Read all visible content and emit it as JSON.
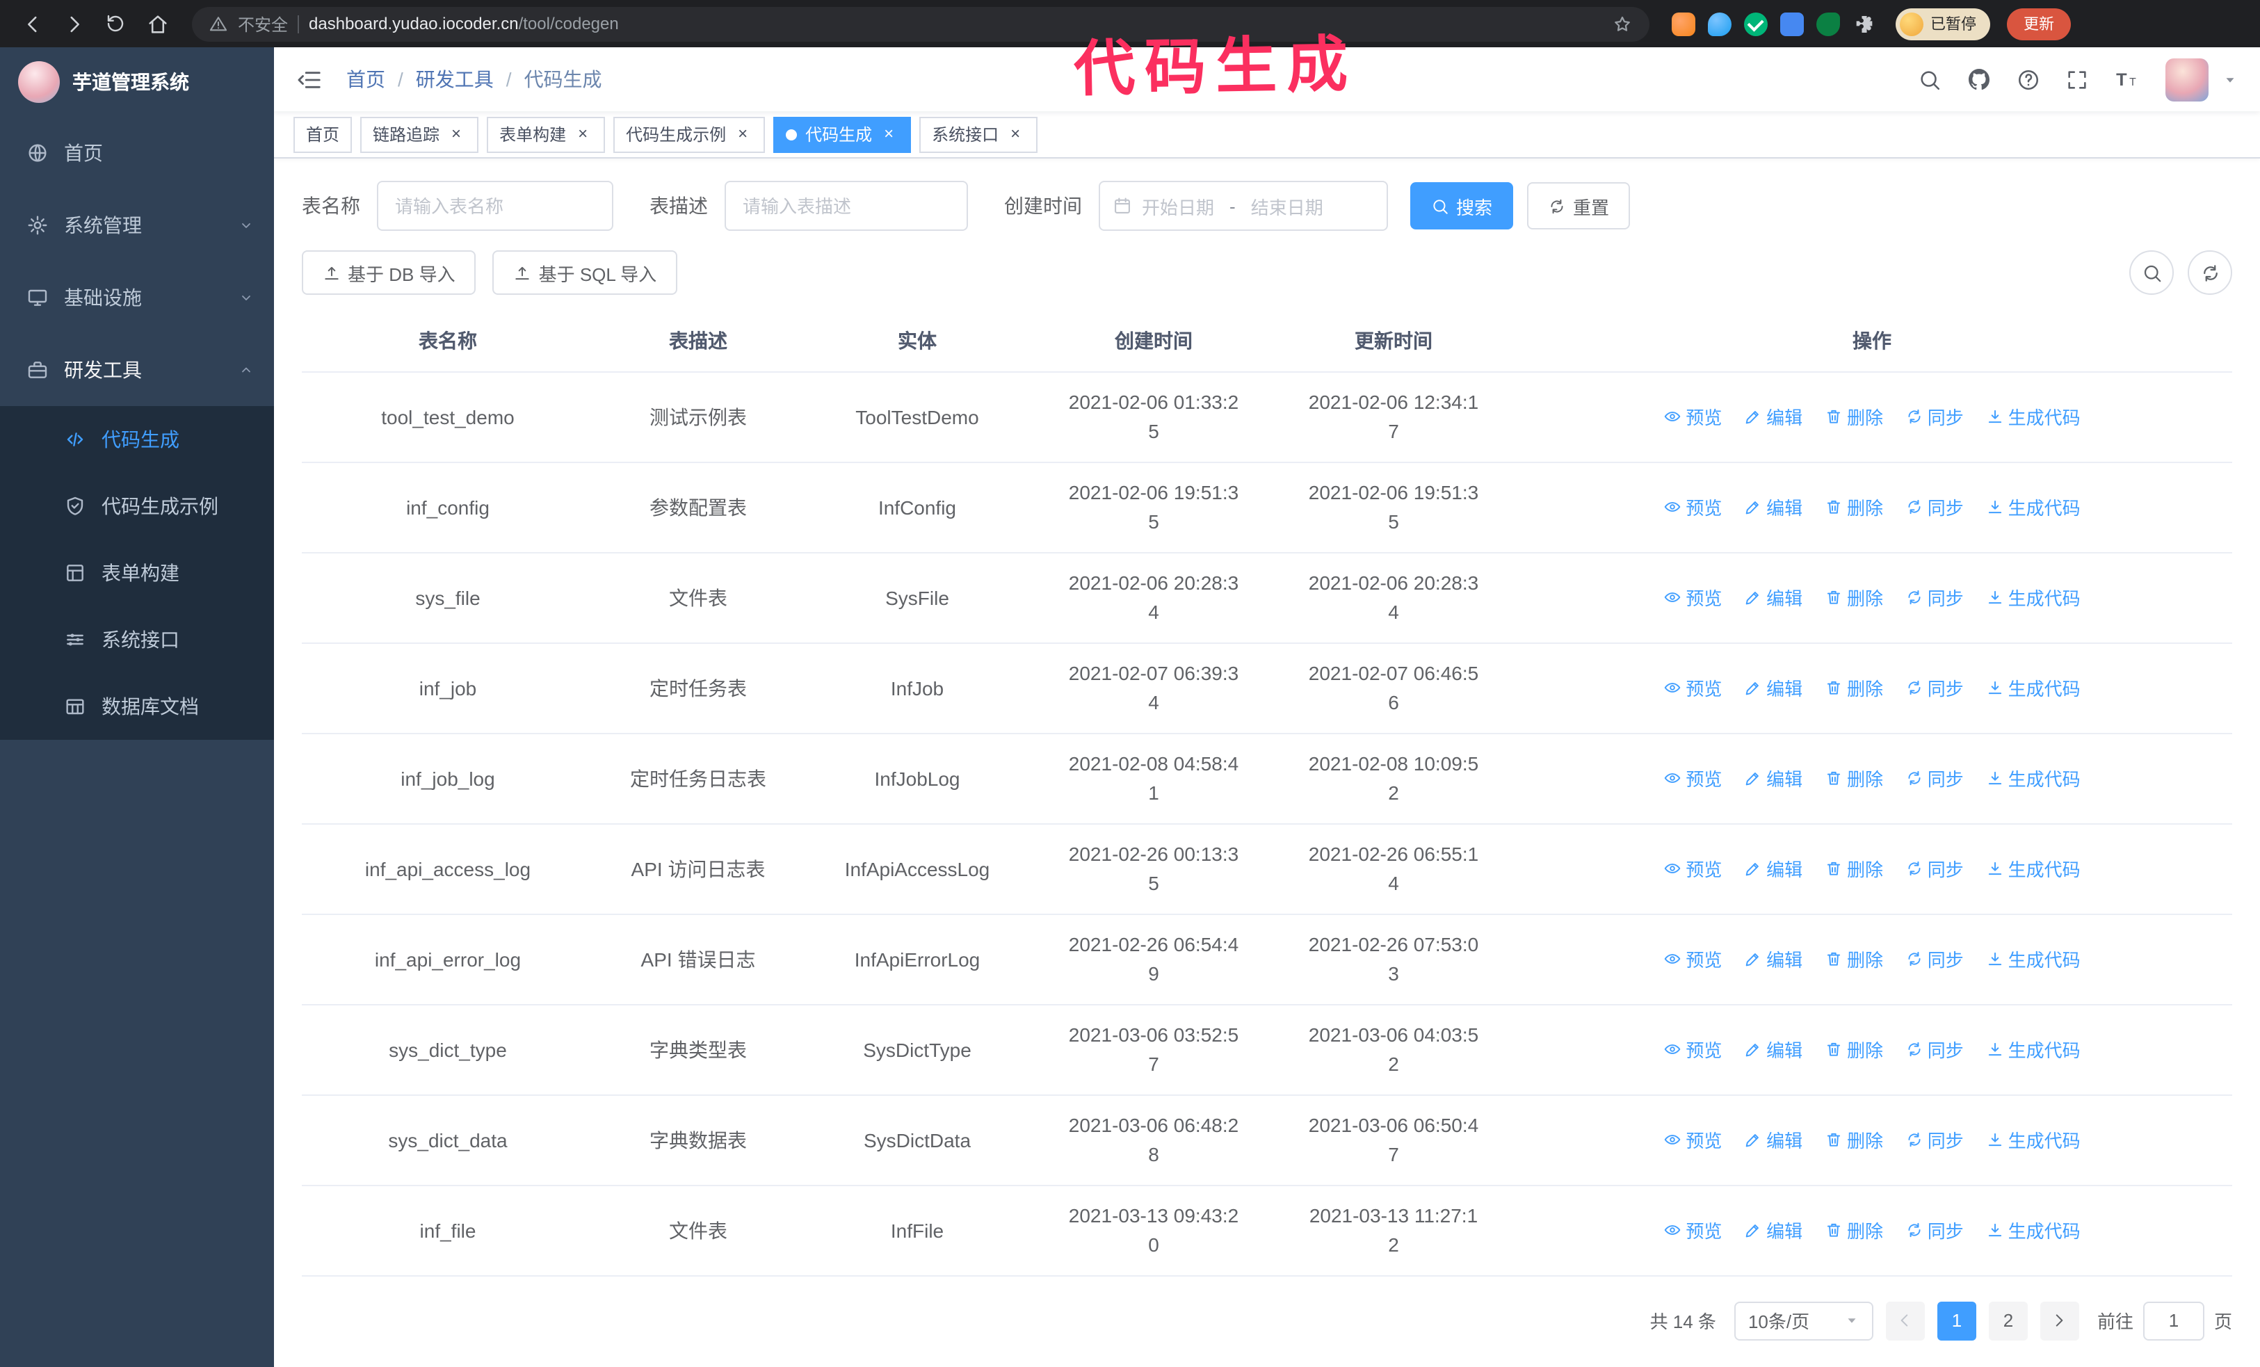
{
  "annotation": {
    "text": "代码生成"
  },
  "browser": {
    "security_label": "不安全",
    "url_host": "dashboard.yudao.iocoder.cn",
    "url_path": "/tool/codegen",
    "paused_badge": "已暂停",
    "update_button": "更新"
  },
  "sidebar": {
    "app_title": "芋道管理系统",
    "items": [
      {
        "label": "首页"
      },
      {
        "label": "系统管理"
      },
      {
        "label": "基础设施"
      },
      {
        "label": "研发工具"
      }
    ],
    "submenu": [
      {
        "label": "代码生成",
        "active": true
      },
      {
        "label": "代码生成示例",
        "active": false
      },
      {
        "label": "表单构建",
        "active": false
      },
      {
        "label": "系统接口",
        "active": false
      },
      {
        "label": "数据库文档",
        "active": false
      }
    ]
  },
  "header": {
    "breadcrumb": [
      "首页",
      "研发工具",
      "代码生成"
    ],
    "separator": "/"
  },
  "tags": [
    {
      "label": "首页",
      "closable": false,
      "active": false
    },
    {
      "label": "链路追踪",
      "closable": true,
      "active": false
    },
    {
      "label": "表单构建",
      "closable": true,
      "active": false
    },
    {
      "label": "代码生成示例",
      "closable": true,
      "active": false
    },
    {
      "label": "代码生成",
      "closable": true,
      "active": true
    },
    {
      "label": "系统接口",
      "closable": true,
      "active": false
    }
  ],
  "filters": {
    "table_name_label": "表名称",
    "table_name_placeholder": "请输入表名称",
    "table_desc_label": "表描述",
    "table_desc_placeholder": "请输入表描述",
    "create_time_label": "创建时间",
    "date_start_placeholder": "开始日期",
    "date_separator": "-",
    "date_end_placeholder": "结束日期",
    "search_button": "搜索",
    "reset_button": "重置"
  },
  "toolbar": {
    "import_db_button": "基于 DB 导入",
    "import_sql_button": "基于 SQL 导入"
  },
  "table": {
    "columns": [
      "表名称",
      "表描述",
      "实体",
      "创建时间",
      "更新时间",
      "操作"
    ],
    "rows": [
      {
        "name": "tool_test_demo",
        "desc": "测试示例表",
        "entity": "ToolTestDemo",
        "created": "2021-02-06 01:33:25",
        "updated": "2021-02-06 12:34:17"
      },
      {
        "name": "inf_config",
        "desc": "参数配置表",
        "entity": "InfConfig",
        "created": "2021-02-06 19:51:35",
        "updated": "2021-02-06 19:51:35"
      },
      {
        "name": "sys_file",
        "desc": "文件表",
        "entity": "SysFile",
        "created": "2021-02-06 20:28:34",
        "updated": "2021-02-06 20:28:34"
      },
      {
        "name": "inf_job",
        "desc": "定时任务表",
        "entity": "InfJob",
        "created": "2021-02-07 06:39:34",
        "updated": "2021-02-07 06:46:56"
      },
      {
        "name": "inf_job_log",
        "desc": "定时任务日志表",
        "entity": "InfJobLog",
        "created": "2021-02-08 04:58:41",
        "updated": "2021-02-08 10:09:52"
      },
      {
        "name": "inf_api_access_log",
        "desc": "API 访问日志表",
        "entity": "InfApiAccessLog",
        "created": "2021-02-26 00:13:35",
        "updated": "2021-02-26 06:55:14"
      },
      {
        "name": "inf_api_error_log",
        "desc": "API 错误日志",
        "entity": "InfApiErrorLog",
        "created": "2021-02-26 06:54:49",
        "updated": "2021-02-26 07:53:03"
      },
      {
        "name": "sys_dict_type",
        "desc": "字典类型表",
        "entity": "SysDictType",
        "created": "2021-03-06 03:52:57",
        "updated": "2021-03-06 04:03:52"
      },
      {
        "name": "sys_dict_data",
        "desc": "字典数据表",
        "entity": "SysDictData",
        "created": "2021-03-06 06:48:28",
        "updated": "2021-03-06 06:50:47"
      },
      {
        "name": "inf_file",
        "desc": "文件表",
        "entity": "InfFile",
        "created": "2021-03-13 09:43:20",
        "updated": "2021-03-13 11:27:12"
      }
    ],
    "row_actions": [
      {
        "label": "预览"
      },
      {
        "label": "编辑"
      },
      {
        "label": "删除"
      },
      {
        "label": "同步"
      },
      {
        "label": "生成代码"
      }
    ]
  },
  "pagination": {
    "total_text": "共 14 条",
    "page_size": "10条/页",
    "pages": [
      "1",
      "2"
    ],
    "active_page": "1",
    "goto_label": "前往",
    "goto_value": "1",
    "goto_suffix": "页"
  },
  "icons": {
    "close_glyph": "×"
  },
  "colors": {
    "primary": "#409eff",
    "sidebar_bg": "#304156",
    "submenu_bg": "#1f2d3d",
    "annotation": "#fb2f5f",
    "update_button": "#d9553f"
  }
}
